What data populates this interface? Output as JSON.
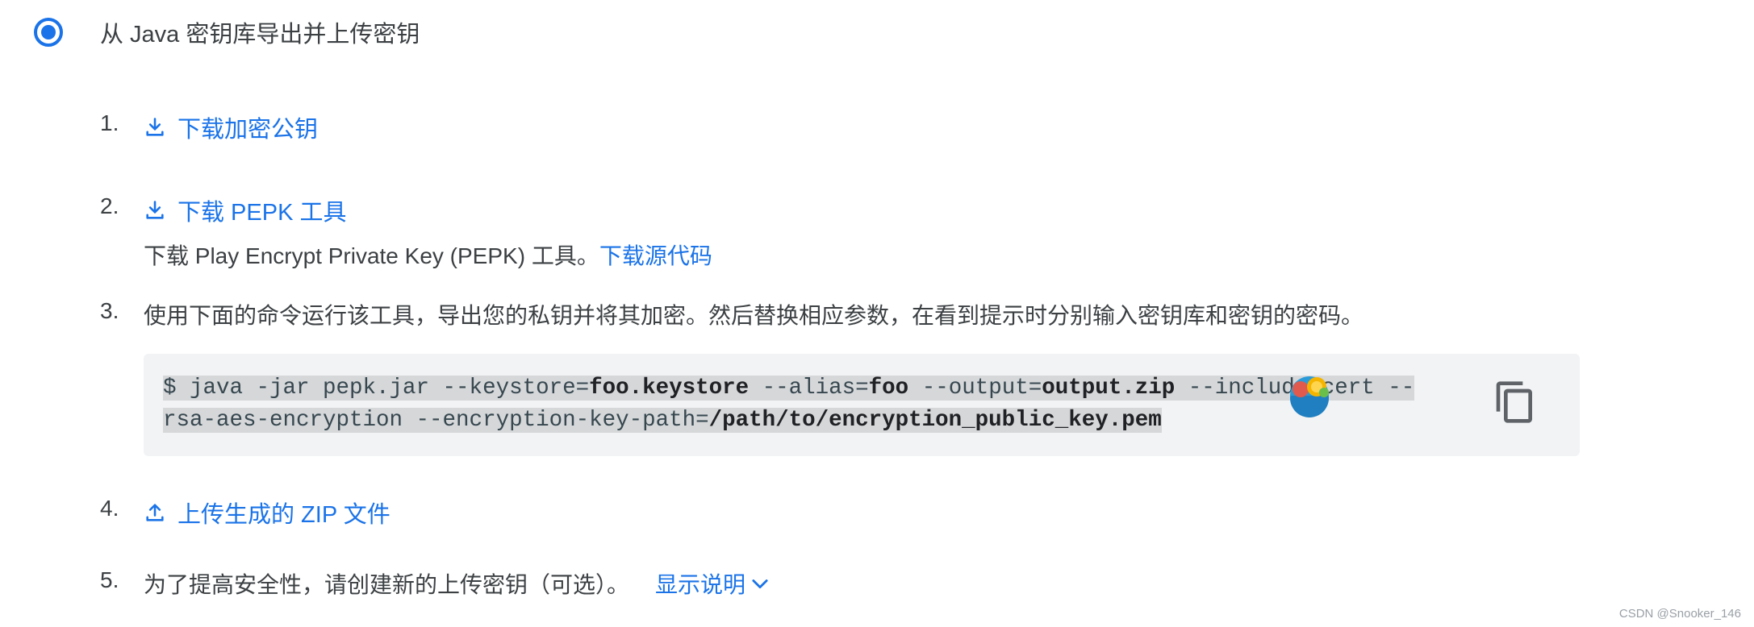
{
  "option": {
    "label": "从 Java 密钥库导出并上传密钥",
    "selected": true
  },
  "steps": [
    {
      "num": "1.",
      "link": "下载加密公钥",
      "icon": "download-icon"
    },
    {
      "num": "2.",
      "link": "下载 PEPK 工具",
      "icon": "download-icon",
      "desc": "下载 Play Encrypt Private Key (PEPK) 工具。",
      "desc_link": "下载源代码"
    },
    {
      "num": "3.",
      "text": "使用下面的命令运行该工具，导出您的私钥并将其加密。然后替换相应参数，在看到提示时分别输入密钥库和密钥的密码。"
    },
    {
      "num": "4.",
      "link": "上传生成的 ZIP 文件",
      "icon": "upload-icon"
    },
    {
      "num": "5.",
      "text": "为了提高安全性，请创建新的上传密钥（可选）。",
      "expand_link": "显示说明"
    }
  ],
  "code": {
    "p1": "$ java -jar pepk.jar --keystore=",
    "keystore": "foo.keystore",
    "p2": " --alias=",
    "alias": "foo",
    "p3": " --output=",
    "output": "output.zip",
    "p4": " --include-cert --",
    "p5": "rsa-aes-encryption --encryption-key-path=",
    "keypath": "/path/to/encryption_public_key.pem",
    "copy_icon": "copy-icon"
  },
  "watermark": "CSDN @Snooker_146",
  "colors": {
    "accent": "#1a73e8",
    "code_bg": "#f1f3f4",
    "highlight": "#d5d7d9"
  }
}
